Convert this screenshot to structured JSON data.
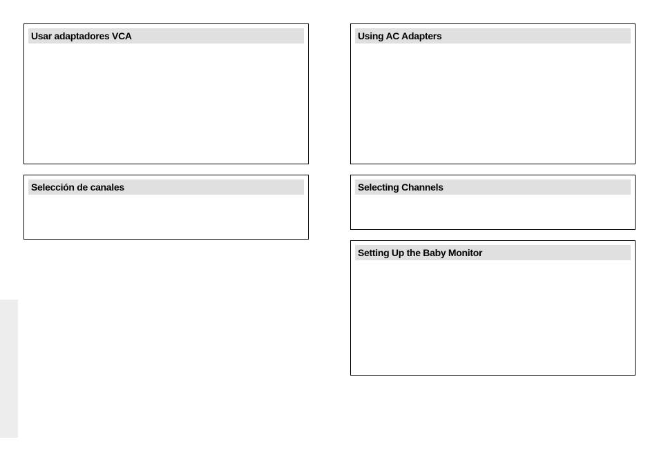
{
  "left": {
    "sections": [
      {
        "title": "Usar adaptadores VCA"
      },
      {
        "title": "Selección de canales"
      }
    ]
  },
  "right": {
    "sections": [
      {
        "title": "Using AC Adapters"
      },
      {
        "title": "Selecting Channels"
      },
      {
        "title": "Setting Up the Baby Monitor"
      }
    ]
  }
}
